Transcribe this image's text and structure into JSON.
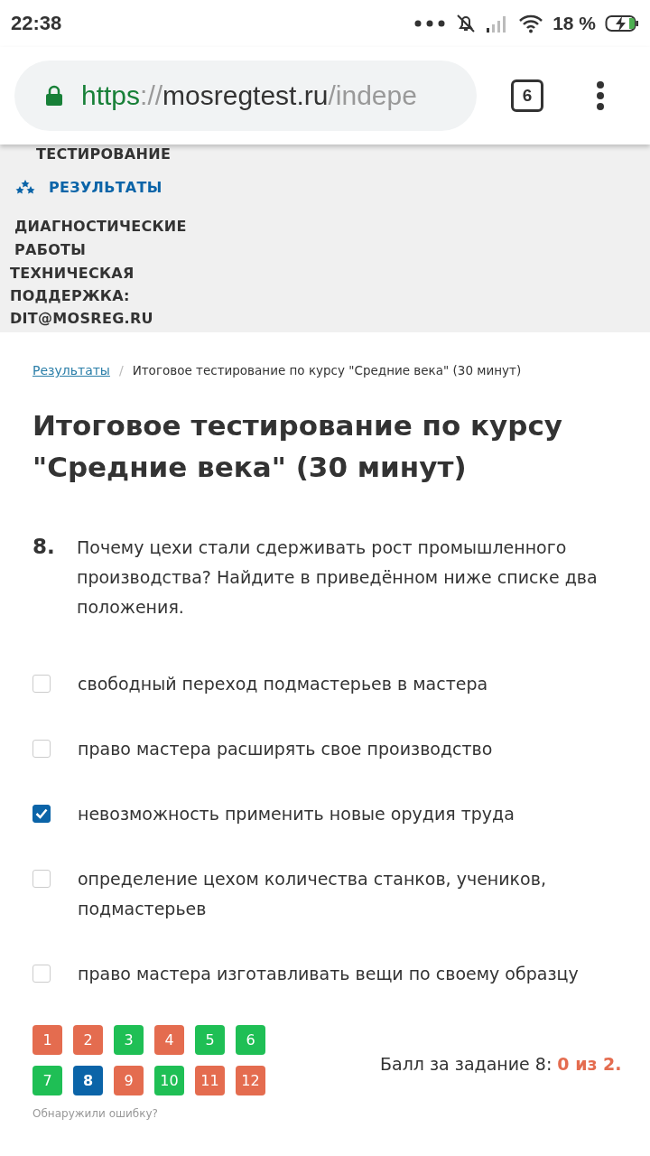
{
  "status_bar": {
    "time": "22:38",
    "battery": "18 %"
  },
  "browser": {
    "url_scheme": "https",
    "url_sep": "://",
    "url_host": "mosregtest.ru",
    "url_path": "/indepe",
    "tab_count": "6"
  },
  "menu": {
    "items": [
      {
        "label": "ТЕСТИРОВАНИЕ",
        "kind": "cut",
        "selected": false
      },
      {
        "label": "РЕЗУЛЬТАТЫ",
        "kind": "icon",
        "selected": true
      },
      {
        "label": "ДИАГНОСТИЧЕСКИЕ\nРАБОТЫ",
        "kind": "plain",
        "selected": false
      },
      {
        "label": "ТЕХНИЧЕСКАЯ\nПОДДЕРЖКА:\nDIT@MOSREG.RU",
        "kind": "contact",
        "selected": false
      }
    ]
  },
  "breadcrumb_separator": "/",
  "breadcrumb": [
    {
      "label": "Результаты",
      "kind": "link"
    },
    {
      "label": "Итоговое тестирование по курсу \"Средние века\" (30 минут)",
      "kind": "current"
    }
  ],
  "title": "Итоговое тестирование по курсу \"Средние века\" (30 минут)",
  "question": {
    "number": "8.",
    "text": "Почему цехи стали сдерживать рост промышленного производства? Найдите в приведённом ниже списке два положения.",
    "options": [
      {
        "label": "свободный переход подмастерьев в мастера",
        "checked": false
      },
      {
        "label": "право мастера расширять свое производство",
        "checked": false
      },
      {
        "label": "невозможность применить новые орудия труда",
        "checked": true
      },
      {
        "label": "определение цехом количества станков, учеников, подмастерьев",
        "checked": false
      },
      {
        "label": "право мастера изготавливать вещи по своему образцу",
        "checked": false
      }
    ]
  },
  "navigator": {
    "items": [
      {
        "label": "1",
        "color": "#e46c4f",
        "selected": false
      },
      {
        "label": "2",
        "color": "#e46c4f",
        "selected": false
      },
      {
        "label": "3",
        "color": "#1fbf55",
        "selected": false
      },
      {
        "label": "4",
        "color": "#e46c4f",
        "selected": false
      },
      {
        "label": "5",
        "color": "#1fbf55",
        "selected": false
      },
      {
        "label": "6",
        "color": "#1fbf55",
        "selected": false
      },
      {
        "label": "7",
        "color": "#1fbf55",
        "selected": false
      },
      {
        "label": "8",
        "color": "#0b64a8",
        "selected": true
      },
      {
        "label": "9",
        "color": "#e46c4f",
        "selected": false
      },
      {
        "label": "10",
        "color": "#1fbf55",
        "selected": false
      },
      {
        "label": "11",
        "color": "#e46c4f",
        "selected": false
      },
      {
        "label": "12",
        "color": "#e46c4f",
        "selected": false
      }
    ],
    "report_link": "Обнаружили ошибку?"
  },
  "score": {
    "label": "Балл за задание 8:",
    "value": "0 из 2."
  }
}
